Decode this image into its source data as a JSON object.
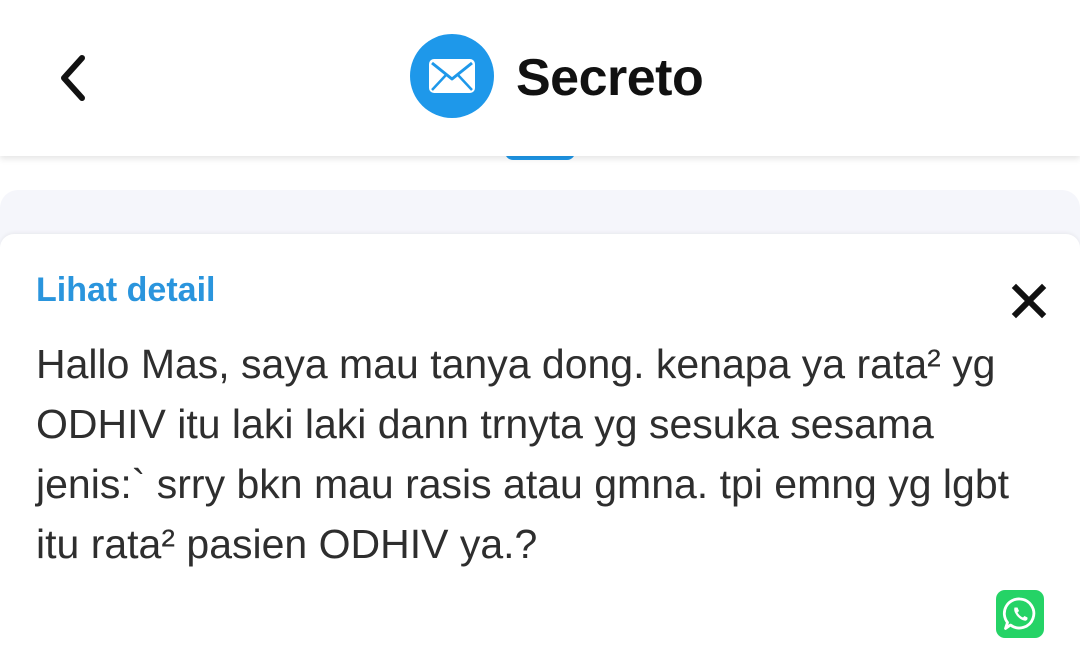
{
  "header": {
    "back_icon": "chevron-left-icon",
    "logo_icon": "envelope-icon",
    "title": "Secreto"
  },
  "message_card": {
    "detail_link": "Lihat detail",
    "close_icon": "close-icon",
    "message": "Hallo Mas, saya mau tanya dong. kenapa ya rata² yg ODHIV itu laki laki dann trnyta yg sesuka sesama jenis:` srry bkn mau rasis atau gmna. tpi emng yg lgbt itu rata² pasien ODHIV ya.?",
    "share_icon": "whatsapp-icon"
  },
  "colors": {
    "accent": "#1e98ea",
    "link": "#2a95dd",
    "whatsapp": "#25d366",
    "band_background": "#f5f6fb",
    "text": "#2e2e2e"
  }
}
